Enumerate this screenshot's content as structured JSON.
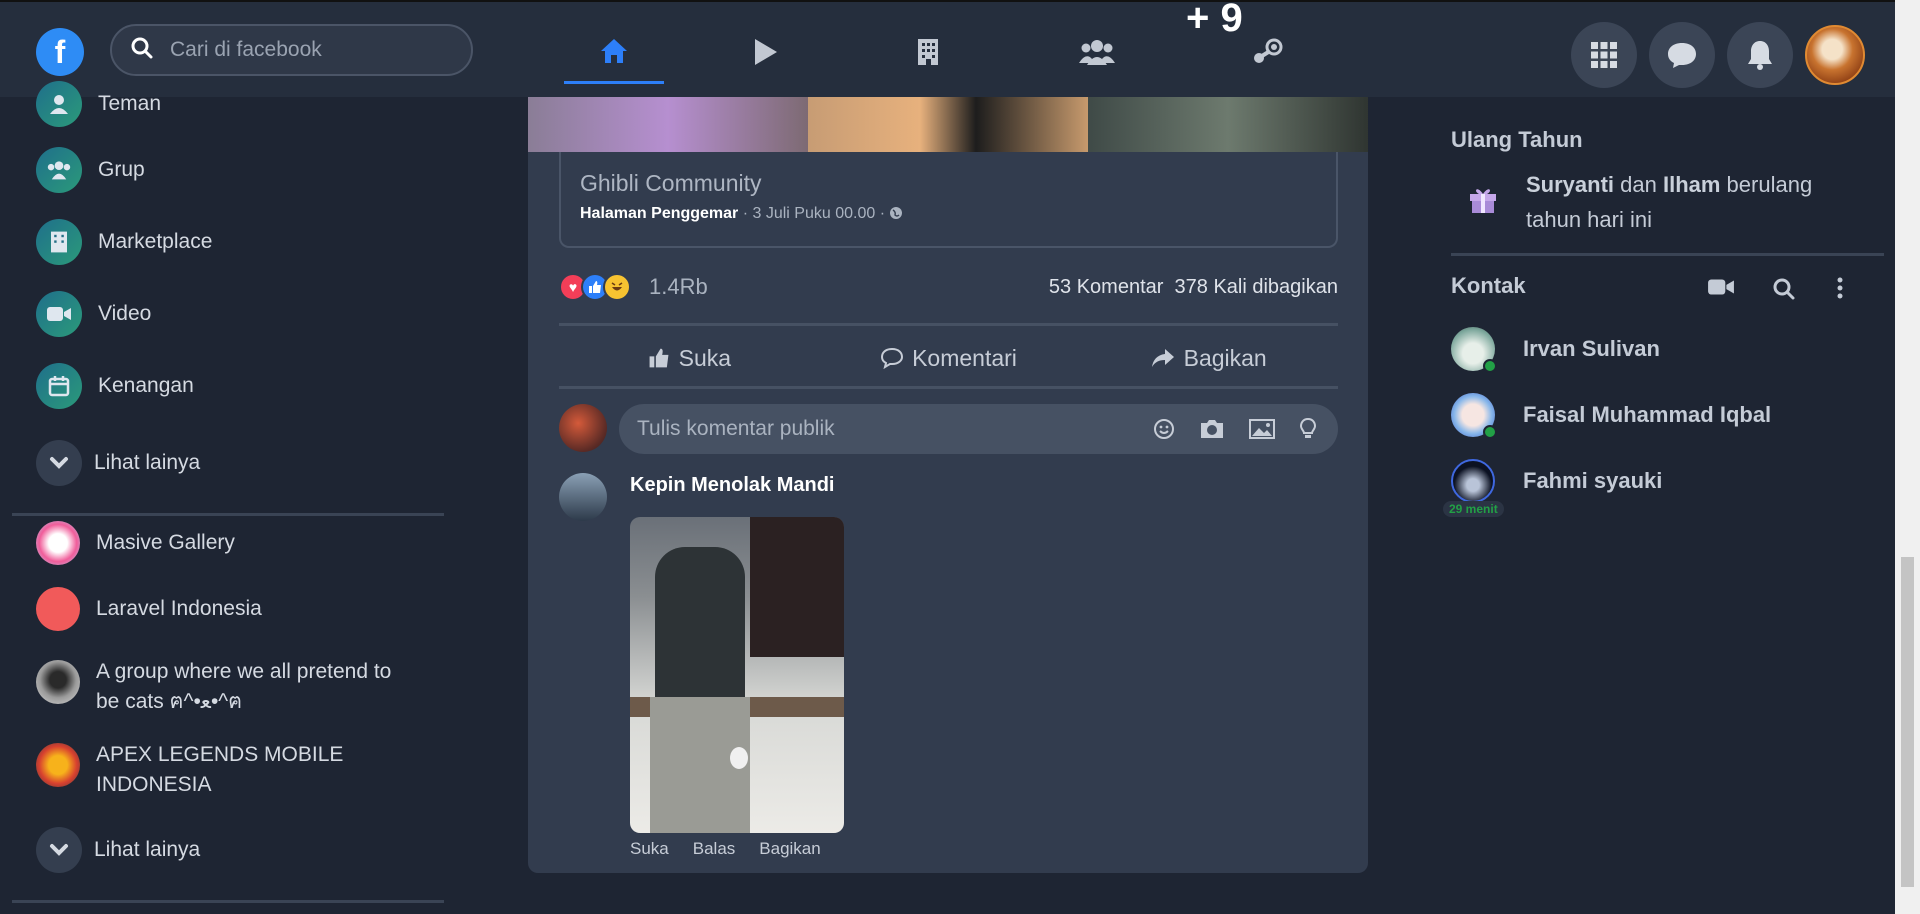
{
  "header": {
    "logo": "f",
    "search_placeholder": "Cari di facebook",
    "nav_badge": "+ 9",
    "nav": [
      "home-icon",
      "video-icon",
      "pages-icon",
      "groups-icon",
      "gaming-icon"
    ],
    "right_buttons": [
      "menu-grid-icon",
      "messenger-icon",
      "notification-icon"
    ]
  },
  "sidebar": {
    "items": [
      {
        "label": "Teman",
        "icon": "friends-icon"
      },
      {
        "label": "Grup",
        "icon": "groups-icon"
      },
      {
        "label": "Marketplace",
        "icon": "marketplace-icon"
      },
      {
        "label": "Video",
        "icon": "video-icon"
      },
      {
        "label": "Kenangan",
        "icon": "calendar-icon"
      }
    ],
    "see_more": "Lihat lainya",
    "groups": [
      {
        "label": "Masive Gallery"
      },
      {
        "label": "Laravel Indonesia"
      },
      {
        "label": "A group where we all pretend to be cats ฅ^•ﻌ•^ฅ"
      },
      {
        "label": "APEX LEGENDS MOBILE INDONESIA"
      }
    ],
    "see_more_2": "Lihat lainya"
  },
  "post": {
    "link_title": "Ghibli Community",
    "link_page_type": "Halaman Penggemar",
    "link_meta": " · 3 Juli Puku 00.00 · ",
    "reaction_count": "1.4Rb",
    "comments_count": "53 Komentar",
    "shares_count": "378 Kali dibagikan",
    "actions": {
      "like": "Suka",
      "comment": "Komentari",
      "share": "Bagikan"
    },
    "comment_placeholder": "Tulis komentar publik",
    "comment": {
      "author": "Kepin Menolak Mandi",
      "actions": [
        "Suka",
        "Balas",
        "Bagikan"
      ]
    }
  },
  "right": {
    "birthday_title": "Ulang Tahun",
    "birthday_name1": "Suryanti",
    "birthday_and": " dan ",
    "birthday_name2": "Ilham",
    "birthday_rest": " berulang tahun hari ini",
    "contacts_title": "Kontak",
    "contacts": [
      {
        "name": "Irvan Sulivan",
        "online": true
      },
      {
        "name": "Faisal Muhammad Iqbal",
        "online": true
      },
      {
        "name": "Fahmi syauki",
        "online": false,
        "last_seen": "29 menit"
      }
    ]
  },
  "colors": {
    "background": "#1e2533",
    "topbar": "#252e3d",
    "card": "#323c4e",
    "accent": "#2d7ff9",
    "online": "#22a046"
  }
}
